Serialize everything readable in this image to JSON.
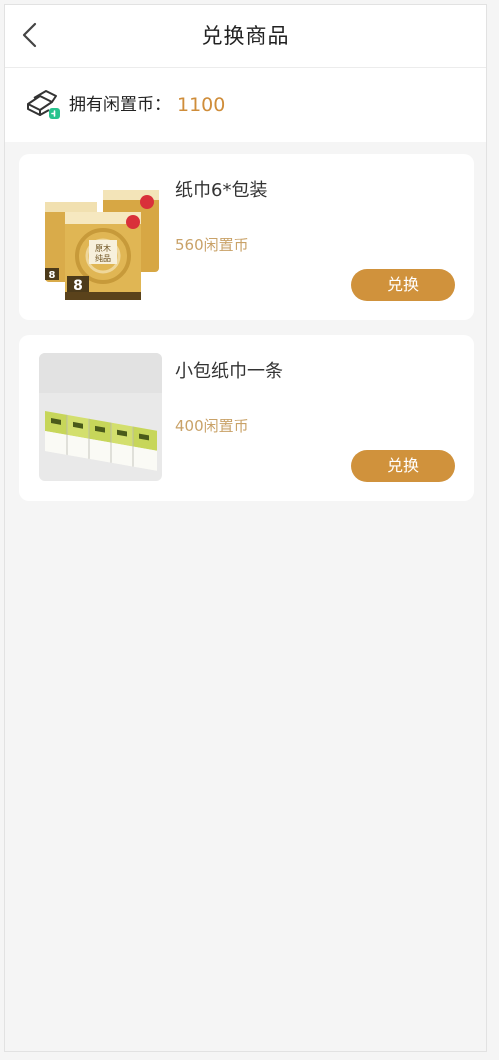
{
  "header": {
    "title": "兑换商品"
  },
  "balance": {
    "label": "拥有闲置币：",
    "value": "1100"
  },
  "products": [
    {
      "name": "纸巾6*包装",
      "price": "560闲置币",
      "redeem_label": "兑换",
      "image": "tissue-pack-product-image"
    },
    {
      "name": "小包纸巾一条",
      "price": "400闲置币",
      "redeem_label": "兑换",
      "image": "pocket-tissue-strip-product-image"
    }
  ],
  "colors": {
    "accent": "#d0923c",
    "price": "#c9a268",
    "balance_value": "#cf8d3a",
    "background": "#f5f5f5"
  }
}
